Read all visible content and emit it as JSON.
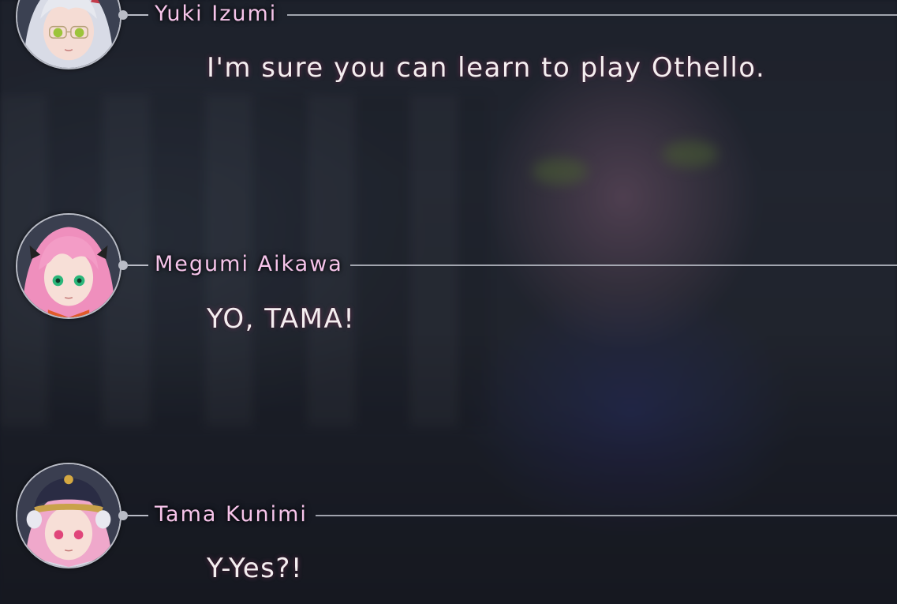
{
  "backlog": {
    "entries": [
      {
        "speaker": "Yuki Izumi",
        "line": "I'm sure you can learn to play Othello.",
        "avatar_icon": "yuki-izumi-portrait"
      },
      {
        "speaker": "Megumi Aikawa",
        "line": "YO, TAMA!",
        "avatar_icon": "megumi-aikawa-portrait"
      },
      {
        "speaker": "Tama Kunimi",
        "line": "Y-Yes?!",
        "avatar_icon": "tama-kunimi-portrait"
      }
    ]
  },
  "colors": {
    "speaker_name": "#f6c4ea",
    "dialogue_text": "#f4eef0",
    "frame": "#b9bcc6",
    "background": "#262a35"
  }
}
